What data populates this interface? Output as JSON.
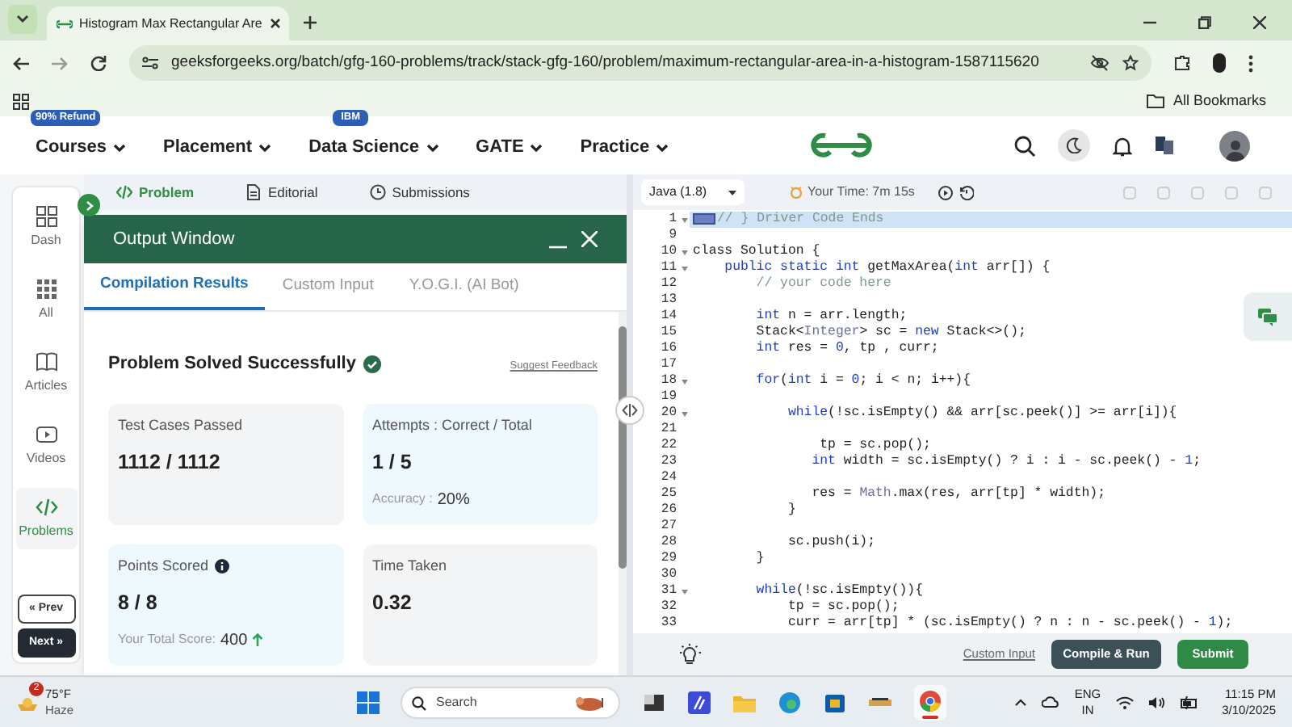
{
  "browser": {
    "tab_title": "Histogram Max Rectangular Are",
    "url": "geeksforgeeks.org/batch/gfg-160-problems/track/stack-gfg-160/problem/maximum-rectangular-area-in-a-histogram-1587115620",
    "bookmarks_label": "All Bookmarks"
  },
  "nav": {
    "items": [
      {
        "label": "Courses",
        "badge": "90% Refund"
      },
      {
        "label": "Placement"
      },
      {
        "label": "Data Science",
        "badge": "IBM"
      },
      {
        "label": "GATE"
      },
      {
        "label": "Practice"
      }
    ]
  },
  "sidebar": {
    "items": [
      {
        "label": "Dash",
        "selected": false
      },
      {
        "label": "All",
        "selected": false
      },
      {
        "label": "Articles",
        "selected": false
      },
      {
        "label": "Videos",
        "selected": false
      },
      {
        "label": "Problems",
        "selected": true
      }
    ],
    "prev": "« Prev",
    "next": "Next »"
  },
  "problem_tabs": [
    {
      "label": "Problem",
      "selected": true
    },
    {
      "label": "Editorial",
      "selected": false
    },
    {
      "label": "Submissions",
      "selected": false
    }
  ],
  "output_window": {
    "title": "Output Window",
    "tabs": [
      {
        "label": "Compilation Results",
        "selected": true
      },
      {
        "label": "Custom Input",
        "selected": false
      },
      {
        "label": "Y.O.G.I. (AI Bot)",
        "selected": false
      }
    ],
    "status": "Problem Solved Successfully",
    "feedback_link": "Suggest Feedback",
    "cards": [
      {
        "title": "Test Cases Passed",
        "value": "1112 / 1112",
        "color": "#f2f4f5"
      },
      {
        "title": "Attempts : Correct / Total",
        "value": "1 / 5",
        "note_label": "Accuracy :",
        "note_value": "20%",
        "color": "#eef9fd"
      },
      {
        "title": "Points Scored",
        "info": true,
        "value": "8 / 8",
        "note_label": "Your Total Score:",
        "note_value": "400",
        "trend_up": true,
        "color": "#eef9fd"
      },
      {
        "title": "Time Taken",
        "value": "0.32",
        "color": "#f2f4f5"
      }
    ]
  },
  "editor": {
    "language": "Java (1.8)",
    "timer": "Your Time: 7m 15s",
    "lines": [
      {
        "number": "1",
        "fold": true,
        "active": true,
        "folded_marker": true,
        "tokens": [
          {
            "kind": "comment",
            "text": "// } Driver Code Ends"
          }
        ]
      },
      {
        "number": "9",
        "fold": false,
        "active": false
      },
      {
        "number": "10",
        "fold": true,
        "active": false,
        "tokens": [
          {
            "kind": "plain",
            "text": "class Solution {"
          }
        ]
      },
      {
        "number": "11",
        "fold": true,
        "active": false,
        "tokens": [
          {
            "kind": "keyword",
            "text": "    public static int"
          },
          {
            "kind": "plain",
            "text": " getMaxArea("
          },
          {
            "kind": "keyword",
            "text": "int"
          },
          {
            "kind": "plain",
            "text": " arr[]) {"
          }
        ]
      },
      {
        "number": "12",
        "fold": false,
        "active": false,
        "tokens": [
          {
            "kind": "comment",
            "text": "        // your code here"
          }
        ]
      },
      {
        "number": "13",
        "fold": false,
        "active": false
      },
      {
        "number": "14",
        "fold": false,
        "active": false,
        "tokens": [
          {
            "kind": "keyword",
            "text": "        int"
          },
          {
            "kind": "plain",
            "text": " n = arr.length;"
          }
        ]
      },
      {
        "number": "15",
        "fold": false,
        "active": false,
        "tokens": [
          {
            "kind": "plain",
            "text": "        Stack<"
          },
          {
            "kind": "type",
            "text": "Integer"
          },
          {
            "kind": "plain",
            "text": "> sc = "
          },
          {
            "kind": "keyword",
            "text": "new"
          },
          {
            "kind": "plain",
            "text": " Stack<>();"
          }
        ]
      },
      {
        "number": "16",
        "fold": false,
        "active": false,
        "tokens": [
          {
            "kind": "keyword",
            "text": "        int"
          },
          {
            "kind": "plain",
            "text": " res = "
          },
          {
            "kind": "number",
            "text": "0"
          },
          {
            "kind": "plain",
            "text": ", tp , curr;"
          }
        ]
      },
      {
        "number": "17",
        "fold": false,
        "active": false
      },
      {
        "number": "18",
        "fold": true,
        "active": false,
        "tokens": [
          {
            "kind": "keyword",
            "text": "        for"
          },
          {
            "kind": "plain",
            "text": "("
          },
          {
            "kind": "keyword",
            "text": "int"
          },
          {
            "kind": "plain",
            "text": " i = "
          },
          {
            "kind": "number",
            "text": "0"
          },
          {
            "kind": "plain",
            "text": "; i < n; i++){"
          }
        ]
      },
      {
        "number": "19",
        "fold": false,
        "active": false
      },
      {
        "number": "20",
        "fold": true,
        "active": false,
        "tokens": [
          {
            "kind": "keyword",
            "text": "            while"
          },
          {
            "kind": "plain",
            "text": "(!sc.isEmpty() && arr[sc.peek()] >= arr[i]){"
          }
        ]
      },
      {
        "number": "21",
        "fold": false,
        "active": false
      },
      {
        "number": "22",
        "fold": false,
        "active": false,
        "tokens": [
          {
            "kind": "plain",
            "text": "                tp = sc.pop();"
          }
        ]
      },
      {
        "number": "23",
        "fold": false,
        "active": false,
        "tokens": [
          {
            "kind": "keyword",
            "text": "               int"
          },
          {
            "kind": "plain",
            "text": " width = sc.isEmpty() ? i : i - sc.peek() - "
          },
          {
            "kind": "number",
            "text": "1"
          },
          {
            "kind": "plain",
            "text": ";"
          }
        ]
      },
      {
        "number": "24",
        "fold": false,
        "active": false
      },
      {
        "number": "25",
        "fold": false,
        "active": false,
        "tokens": [
          {
            "kind": "plain",
            "text": "               res = "
          },
          {
            "kind": "type",
            "text": "Math"
          },
          {
            "kind": "plain",
            "text": ".max(res, arr[tp] * width);"
          }
        ]
      },
      {
        "number": "26",
        "fold": false,
        "active": false,
        "tokens": [
          {
            "kind": "plain",
            "text": "            }"
          }
        ]
      },
      {
        "number": "27",
        "fold": false,
        "active": false
      },
      {
        "number": "28",
        "fold": false,
        "active": false,
        "tokens": [
          {
            "kind": "plain",
            "text": "            sc.push(i);"
          }
        ]
      },
      {
        "number": "29",
        "fold": false,
        "active": false,
        "tokens": [
          {
            "kind": "plain",
            "text": "        }"
          }
        ]
      },
      {
        "number": "30",
        "fold": false,
        "active": false
      },
      {
        "number": "31",
        "fold": true,
        "active": false,
        "tokens": [
          {
            "kind": "keyword",
            "text": "        while"
          },
          {
            "kind": "plain",
            "text": "(!sc.isEmpty()){"
          }
        ]
      },
      {
        "number": "32",
        "fold": false,
        "active": false,
        "tokens": [
          {
            "kind": "plain",
            "text": "            tp = sc.pop();"
          }
        ]
      },
      {
        "number": "33",
        "fold": false,
        "active": false,
        "tokens": [
          {
            "kind": "plain",
            "text": "            curr = arr[tp] * (sc.isEmpty() ? n : n - sc.peek() - "
          },
          {
            "kind": "number",
            "text": "1"
          },
          {
            "kind": "plain",
            "text": ");"
          }
        ]
      }
    ],
    "custom_input": "Custom Input",
    "compile": "Compile & Run",
    "submit": "Submit"
  },
  "taskbar": {
    "weather_badge": "2",
    "temperature": "75°F",
    "condition": "Haze",
    "search": "Search",
    "lang_top": "ENG",
    "lang_bottom": "IN",
    "time": "11:15 PM",
    "date": "3/10/2025"
  }
}
